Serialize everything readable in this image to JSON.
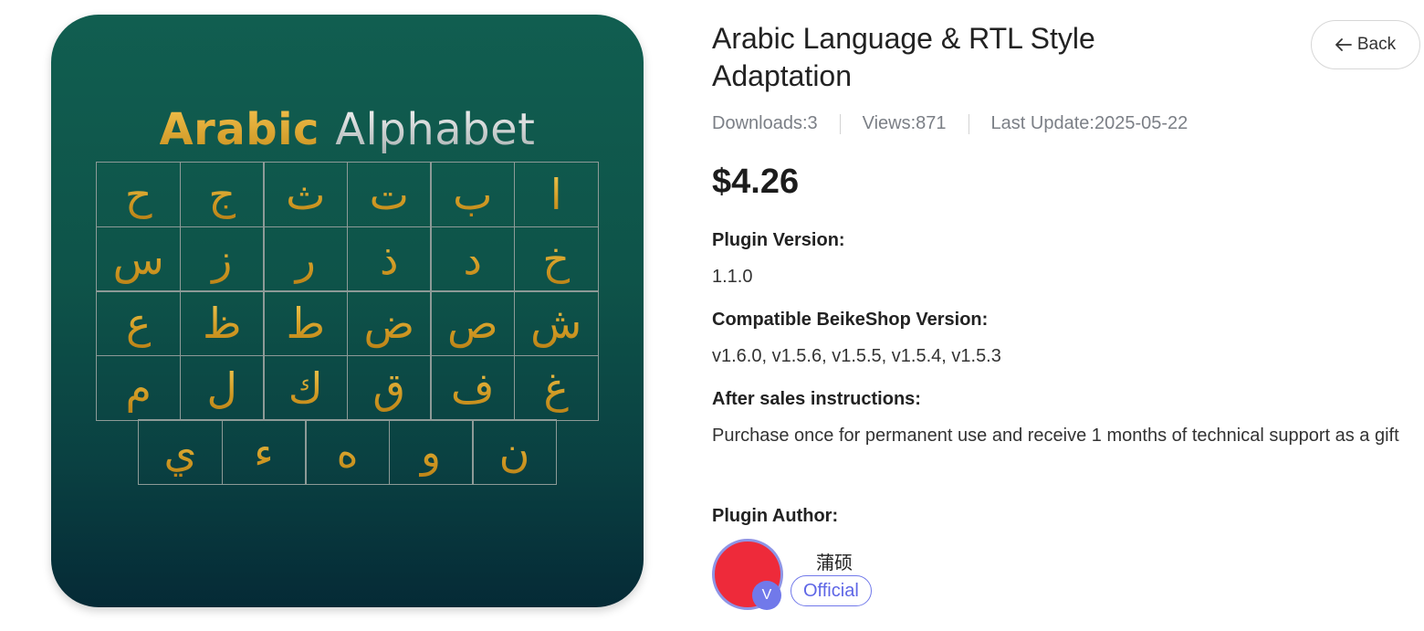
{
  "product_image": {
    "title_part1": "Arabic",
    "title_part2": "Alphabet",
    "rows": [
      [
        "ح",
        "ج",
        "ث",
        "ت",
        "ب",
        "ا"
      ],
      [
        "س",
        "ز",
        "ر",
        "ذ",
        "د",
        "خ"
      ],
      [
        "ع",
        "ظ",
        "ط",
        "ض",
        "ص",
        "ش"
      ],
      [
        "م",
        "ل",
        "ك",
        "ق",
        "ف",
        "غ"
      ],
      [
        "ي",
        "ء",
        "ه",
        "و",
        "ن"
      ]
    ]
  },
  "product": {
    "title": "Arabic Language & RTL Style Adaptation",
    "back_label": "Back",
    "downloads": "Downloads:3",
    "views": "Views:871",
    "last_update": "Last Update:2025-05-22",
    "price": "$4.26",
    "plugin_version_label": "Plugin Version:",
    "plugin_version": "1.1.0",
    "compatible_label": "Compatible BeikeShop Version:",
    "compatible_versions": "v1.6.0, v1.5.6, v1.5.5, v1.5.4, v1.5.3",
    "after_sales_label": "After sales instructions:",
    "after_sales_text": "Purchase once for permanent use and receive 1 months of technical support as a gift",
    "author_label": "Plugin Author:"
  },
  "author": {
    "name": "蒲硕",
    "verified_mark": "V",
    "badge": "Official",
    "avatar_color": "#ee2a3a",
    "accent_color": "#7179ea"
  }
}
